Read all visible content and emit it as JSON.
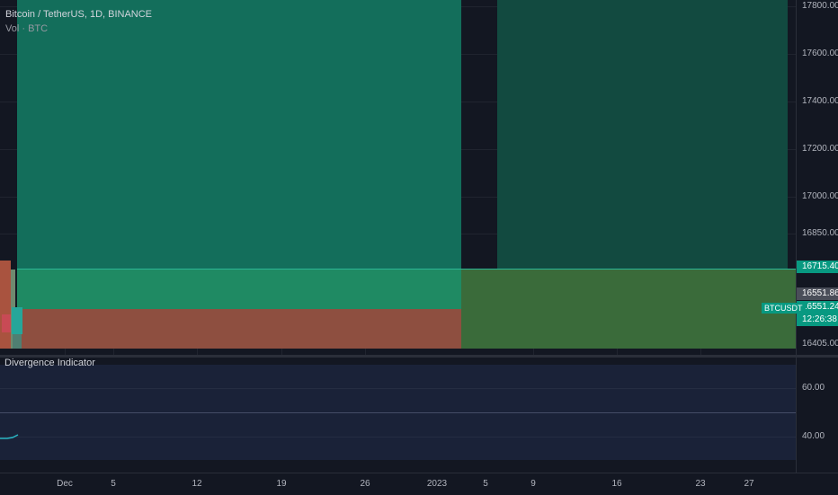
{
  "legend": {
    "symbol_line": "Bitcoin / TetherUS, 1D, BINANCE",
    "volume_line": "Vol · BTC"
  },
  "price_axis": {
    "ticks": [
      "17800.00",
      "17600.00",
      "17400.00",
      "17200.00",
      "17000.00",
      "16850.00",
      "16405.00"
    ],
    "labels": {
      "upper_level": "16715.40",
      "last_price": "16551.86",
      "current_price": "16551.24",
      "countdown": "12:26:38"
    }
  },
  "symbol_tag": "BTCUSDT",
  "indicator": {
    "title": "Divergence Indicator",
    "ticks": [
      "60.00",
      "40.00"
    ]
  },
  "time_axis": {
    "ticks": [
      "Dec",
      "5",
      "12",
      "19",
      "26",
      "2023",
      "5",
      "9",
      "16",
      "23",
      "27"
    ]
  },
  "colors": {
    "background": "#131722",
    "teal_zone": "#136e5b",
    "dark_teal_zone": "#124a40",
    "green_band": "#1f8a63",
    "red_band": "#8e4f40",
    "olive_band": "#3a6b3a",
    "label_teal": "#089981",
    "label_grey": "#4a4e59",
    "indicator_band": "#1a2238",
    "indicator_line": "#29b6c4"
  }
}
